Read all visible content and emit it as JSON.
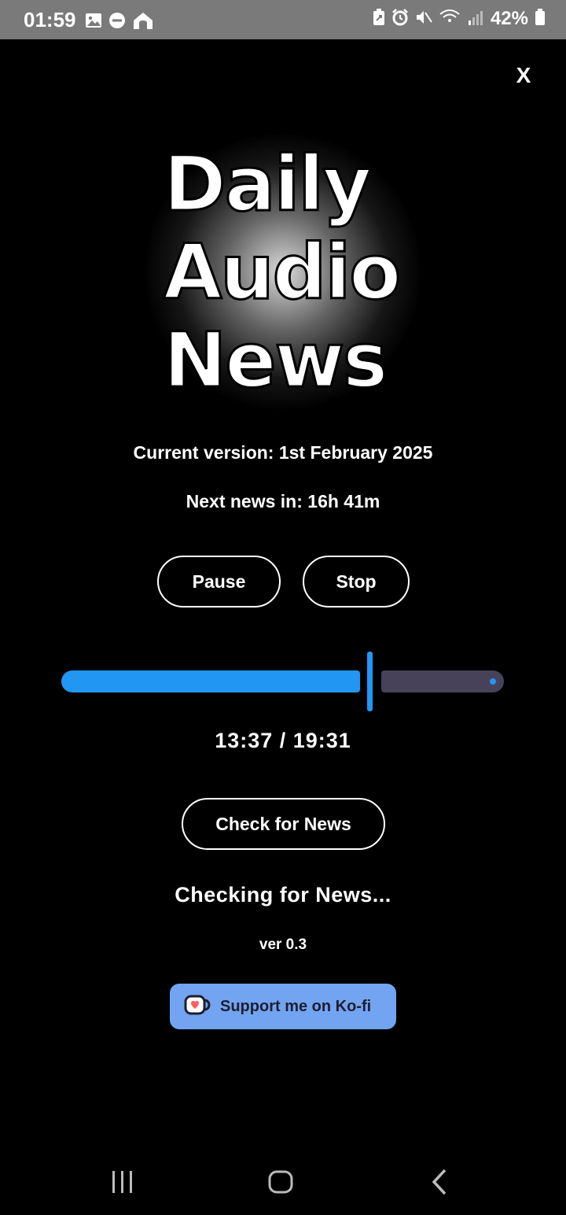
{
  "status_bar": {
    "time": "01:59",
    "battery": "42%",
    "left_icons": [
      "image-icon",
      "do-not-disturb-icon",
      "home-icon"
    ],
    "right_icons": [
      "battery-saver-icon",
      "alarm-icon",
      "mute-icon",
      "wifi-calling-icon",
      "signal-icon"
    ]
  },
  "close_label": "X",
  "logo": {
    "line1": "Daily",
    "line2": "Audio",
    "line3": "News"
  },
  "current_version": "Current version: 1st February 2025",
  "next_news": "Next news in: 16h 41m",
  "controls": {
    "pause_label": "Pause",
    "stop_label": "Stop"
  },
  "playback": {
    "elapsed": "13:37",
    "total": "19:31",
    "time_display": "13:37 / 19:31",
    "progress_fraction": 0.69,
    "accent_color": "#2196f3",
    "track_color": "#47425a"
  },
  "check_button_label": "Check for News",
  "status_message": "Checking for News...",
  "version_label": "ver 0.3",
  "kofi": {
    "label": "Support me on Ko-fi",
    "background": "#72a4f2"
  },
  "navigation": [
    "recent-apps-icon",
    "home-button-icon",
    "back-icon"
  ]
}
